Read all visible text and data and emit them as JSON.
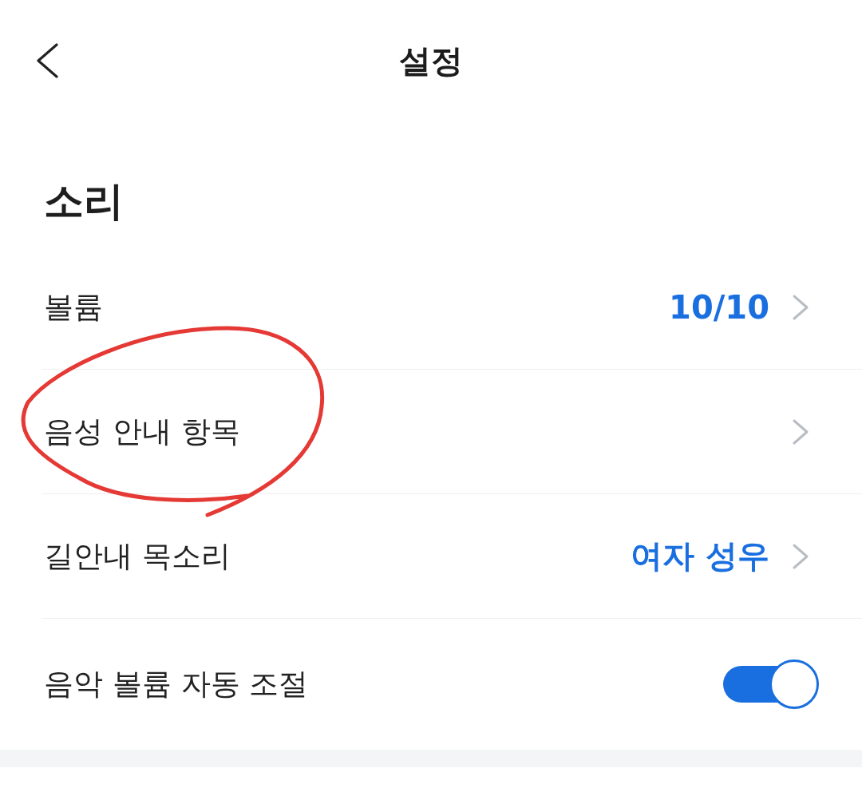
{
  "header": {
    "title": "설정"
  },
  "section": {
    "title": "소리",
    "items": [
      {
        "kind": "link",
        "label": "볼륨",
        "value": "10/10",
        "circled": false
      },
      {
        "kind": "link",
        "label": "음성 안내 항목",
        "circled": true
      },
      {
        "kind": "link",
        "label": "길안내 목소리",
        "value": "여자 성우",
        "circled": false
      },
      {
        "kind": "toggle",
        "label": "음악 볼륨 자동 조절",
        "on": true,
        "circled": false
      }
    ]
  }
}
